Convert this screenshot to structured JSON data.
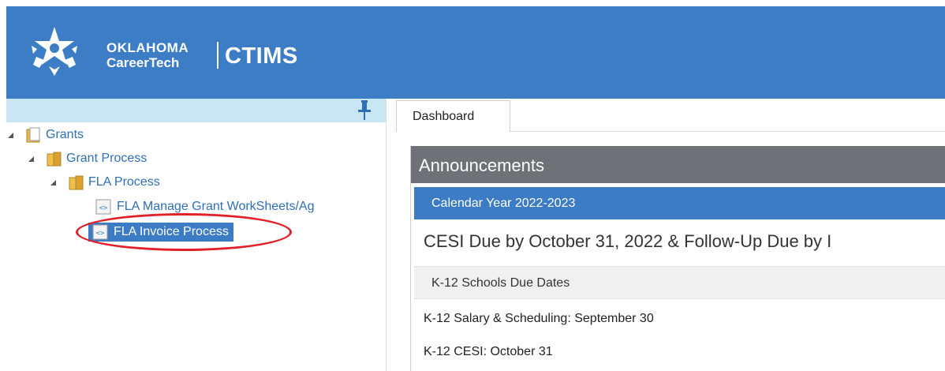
{
  "brand": {
    "line1": "OKLAHOMA",
    "line2": "CareerTech",
    "product": "CTIMS",
    "header_color": "#3d7dc6"
  },
  "sidebar": {
    "tree": {
      "root": {
        "label": "Grants",
        "icon": "document-folder-icon"
      },
      "child": {
        "label": "Grant Process",
        "icon": "folder-icon"
      },
      "grandchild": {
        "label": "FLA Process",
        "icon": "folder-icon"
      },
      "items": [
        {
          "label": "FLA Manage Grant WorkSheets/Ag",
          "icon": "code-page-icon",
          "selected": false
        },
        {
          "label": "FLA Invoice Process",
          "icon": "code-page-icon",
          "selected": true
        }
      ]
    },
    "selected_color": "#3b7cc4",
    "highlight_color": "#e0202a"
  },
  "tabs": [
    {
      "label": "Dashboard",
      "active": true
    }
  ],
  "announcements": {
    "title": "Announcements",
    "calendar_label": "Calendar Year 2022-2023",
    "headline": "CESI Due by October 31, 2022 & Follow-Up Due by I",
    "subheading": "K-12 Schools Due Dates",
    "rows": [
      "K-12 Salary & Scheduling: September 30",
      "K-12 CESI: October 31"
    ]
  }
}
